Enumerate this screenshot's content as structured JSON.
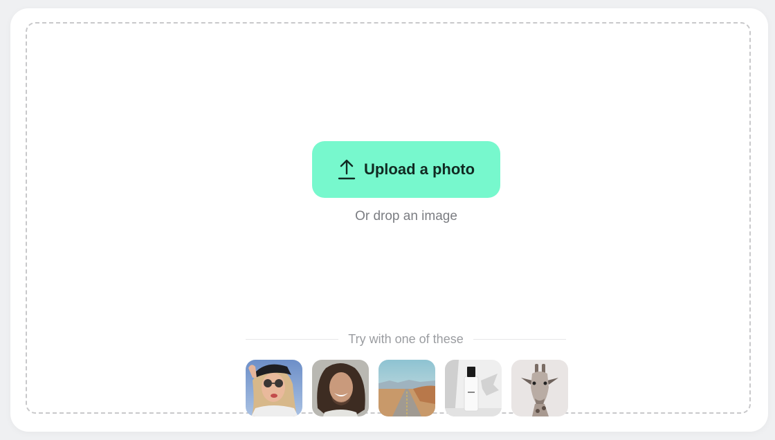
{
  "upload": {
    "button_label": "Upload a photo",
    "icon": "upload-icon",
    "drop_hint": "Or drop an image",
    "accent_color": "#77f8cd"
  },
  "samples": {
    "heading": "Try with one of these",
    "items": [
      {
        "name": "woman-with-sunglasses",
        "description": "Woman wearing cap and sunglasses"
      },
      {
        "name": "smiling-man",
        "description": "Smiling man with long hair"
      },
      {
        "name": "desert-road",
        "description": "Desert road landscape"
      },
      {
        "name": "perfume-bottle",
        "description": "Perfume bottle product shot"
      },
      {
        "name": "giraffe",
        "description": "Giraffe portrait"
      }
    ]
  }
}
